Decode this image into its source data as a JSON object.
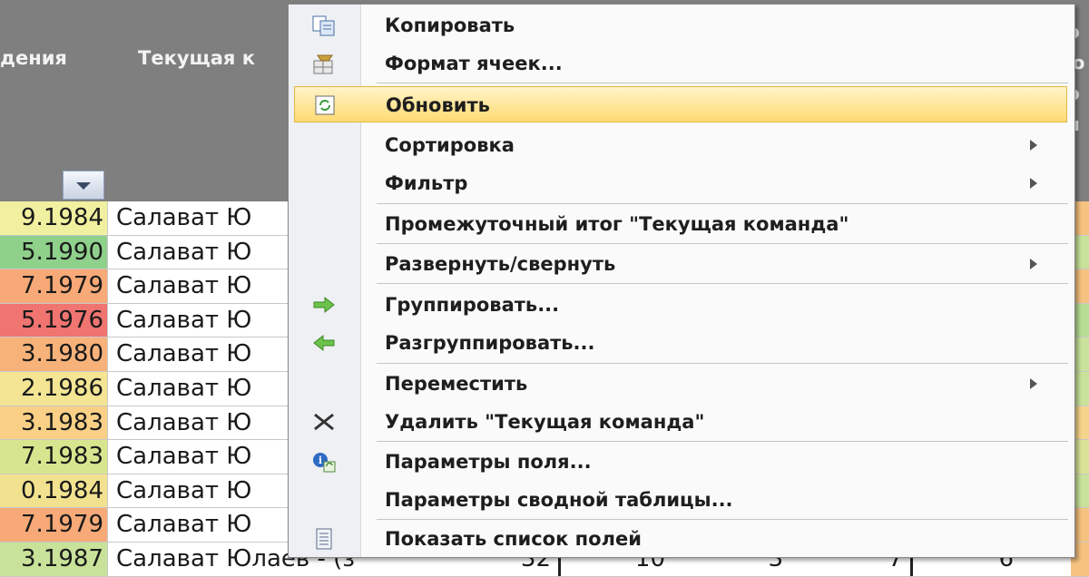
{
  "header": {
    "col1_label": "дения",
    "col2_label": "Текущая к",
    "right_fragments": [
      "о",
      "ю",
      "о",
      "н"
    ]
  },
  "rows": [
    {
      "date": "9.1984",
      "team": "Салават Ю",
      "color": "#f0f0a0",
      "rc": "#f5c280"
    },
    {
      "date": "5.1990",
      "team": "Салават Ю",
      "color": "#8fd18b",
      "rc": "#c8e29a"
    },
    {
      "date": "7.1979",
      "team": "Салават Ю",
      "color": "#f7a977",
      "rc": "#f5c280"
    },
    {
      "date": "5.1976",
      "team": "Салават Ю",
      "color": "#f07470",
      "rc": "#b7dc94"
    },
    {
      "date": "3.1980",
      "team": "Салават Ю",
      "color": "#f7b27a",
      "rc": "#c8e29a"
    },
    {
      "date": "2.1986",
      "team": "Салават Ю",
      "color": "#f3e593",
      "rc": "#c8e29a"
    },
    {
      "date": "3.1983",
      "team": "Салават Ю",
      "color": "#f9d086",
      "rc": "#f5d58b"
    },
    {
      "date": "7.1983",
      "team": "Салават Ю",
      "color": "#d7e68e",
      "rc": "#d9e397"
    },
    {
      "date": "0.1984",
      "team": "Салават Ю",
      "color": "#f2e290",
      "rc": "#c8e29a"
    },
    {
      "date": "7.1979",
      "team": "Салават Ю",
      "color": "#f7a977",
      "rc": "#f5c280"
    },
    {
      "date": "3.1987",
      "team": "Салават Юлаев - (з",
      "color": "#c8e29a",
      "rc": "#f5c280"
    }
  ],
  "last_row_numbers": [
    "32",
    "10",
    "3",
    "7",
    "6"
  ],
  "menu": {
    "items": [
      {
        "label": "Копировать",
        "icon": "copy-icon",
        "submenu": false
      },
      {
        "label": "Формат ячеек...",
        "icon": "format-cells-icon",
        "submenu": false
      },
      {
        "label": "Обновить",
        "icon": "refresh-icon",
        "submenu": false,
        "highlighted": true
      },
      {
        "label": "Сортировка",
        "icon": "",
        "submenu": true
      },
      {
        "label": "Фильтр",
        "icon": "",
        "submenu": true
      },
      {
        "label": "Промежуточный итог \"Текущая команда\"",
        "icon": "",
        "submenu": false
      },
      {
        "label": "Развернуть/свернуть",
        "icon": "",
        "submenu": true
      },
      {
        "label": "Группировать...",
        "icon": "group-arrow-icon",
        "submenu": false
      },
      {
        "label": "Разгруппировать...",
        "icon": "ungroup-arrow-icon",
        "submenu": false
      },
      {
        "label": "Переместить",
        "icon": "",
        "submenu": true
      },
      {
        "label": "Удалить \"Текущая команда\"",
        "icon": "delete-icon",
        "submenu": false
      },
      {
        "label": "Параметры поля...",
        "icon": "field-settings-icon",
        "submenu": false
      },
      {
        "label": "Параметры сводной таблицы...",
        "icon": "",
        "submenu": false
      },
      {
        "label": "Показать список полей",
        "icon": "field-list-icon",
        "submenu": false
      }
    ]
  }
}
